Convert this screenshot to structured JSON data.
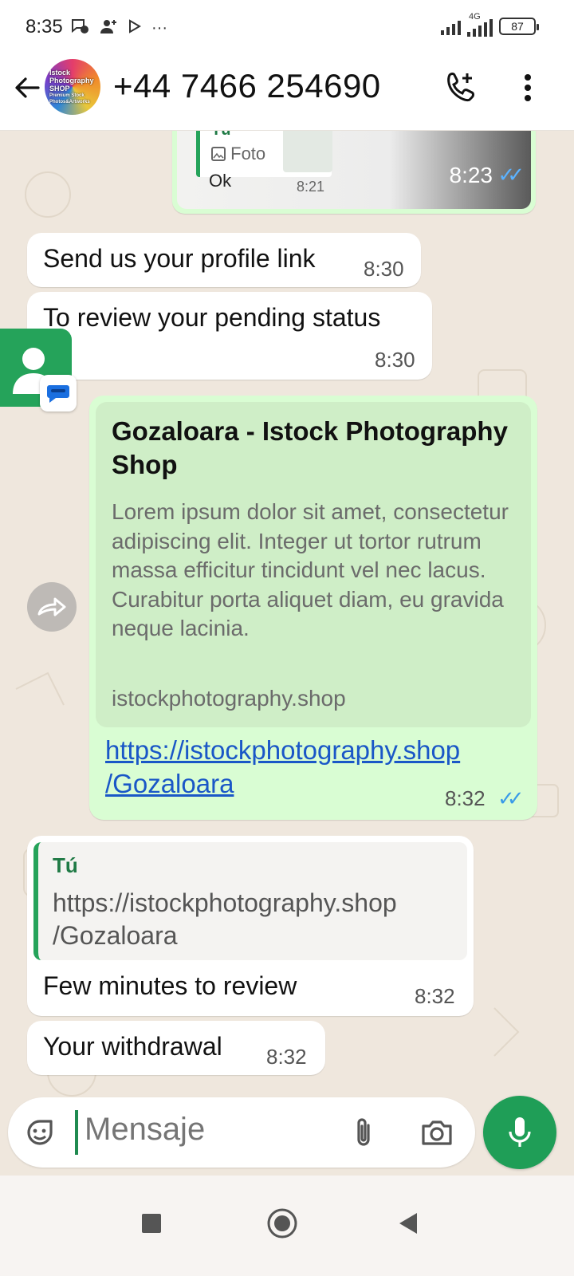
{
  "status_bar": {
    "time": "8:35",
    "network_label": "4G",
    "battery": "87",
    "more": "···"
  },
  "header": {
    "contact": "+44 7466 254690",
    "avatar_lines": [
      "Istock",
      "Photography",
      "SHOP",
      "Premium Stock",
      "Photos&Artworks"
    ]
  },
  "messages": {
    "image_reply": {
      "quote_author": "Tú",
      "quote_label": "Foto",
      "reply_text": "Ok",
      "reply_time": "8:21",
      "time": "8:23"
    },
    "m1": {
      "text": "Send us your profile link",
      "time": "8:30"
    },
    "m2": {
      "text": "To review your pending status",
      "time": "8:30"
    },
    "link_msg": {
      "preview_title": "Gozaloara - Istock Photography Shop",
      "preview_description": "Lorem ipsum dolor sit amet, consectetur adipiscing elit. Integer ut tortor rutrum massa efficitur tincidunt vel nec lacus. Curabitur porta aliquet diam, eu gravida neque lacinia.",
      "preview_domain": "istockphotography.shop",
      "link_line1": "https://istockphotography.shop",
      "link_line2": "/Gozaloara",
      "time": "8:32"
    },
    "m3": {
      "quote_author": "Tú",
      "quote_line1": "https://istockphotography.shop",
      "quote_line2": "/Gozaloara",
      "text": "Few minutes to review",
      "time": "8:32"
    },
    "m4": {
      "text": "Your withdrawal",
      "time": "8:32"
    }
  },
  "composer": {
    "placeholder": "Mensaje"
  },
  "colors": {
    "accent_green": "#1f9e57",
    "outgoing_bubble": "#d9fdd3",
    "read_ticks": "#3a9be8",
    "link": "#1a57c7"
  },
  "icons": [
    "back-arrow-icon",
    "add-call-icon",
    "more-vert-icon",
    "emoji-icon",
    "attach-icon",
    "camera-icon",
    "mic-icon",
    "forward-icon",
    "contact-icon",
    "messages-icon"
  ]
}
